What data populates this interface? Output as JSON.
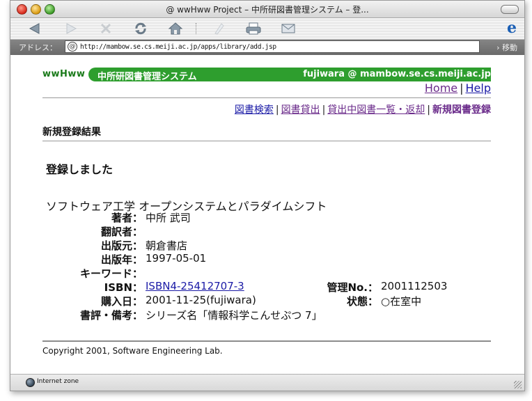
{
  "window": {
    "title": "@ wwHww Project – 中所研図書管理システム – 登..."
  },
  "toolbar": {
    "buttons": [
      "back-icon",
      "forward-icon",
      "stop-icon",
      "refresh-icon",
      "home-icon",
      "favorites-icon",
      "print-icon",
      "mail-icon"
    ]
  },
  "address": {
    "label": "アドレス：",
    "url": "http://mambow.se.cs.meiji.ac.jp/apps/library/add.jsp",
    "go_label": "› 移動"
  },
  "header": {
    "logo": "wwHww",
    "system_name": "中所研図書管理システム",
    "user": "fujiwara @ mambow.se.cs.meiji.ac.jp",
    "home_link": "Home",
    "help_link": "Help"
  },
  "nav": {
    "search": "図書検索",
    "lend": "図書貸出",
    "return": "貸出中図書一覧・返却",
    "register": "新規図書登録"
  },
  "section_title": "新規登録結果",
  "message": "登録しました",
  "book": {
    "title": "ソフトウェア工学 オープンシステムとパラダイムシフト",
    "author_label": "著者：",
    "author": "中所 武司",
    "translator_label": "翻訳者：",
    "translator": "",
    "publisher_label": "出版元：",
    "publisher": "朝倉書店",
    "year_label": "出版年：",
    "year": "1997-05-01",
    "keyword_label": "キーワード：",
    "keyword": "",
    "isbn_label": "ISBN：",
    "isbn": "ISBN4-25412707-3",
    "management_label": "管理No.：",
    "management_no": "2001112503",
    "purchase_label": "購入日：",
    "purchase": "2001-11-25(fujiwara)",
    "status_label": "状態：",
    "status": "○在室中",
    "notes_label": "書評・備考：",
    "notes": "シリーズ名「情報科学こんせぷつ 7」"
  },
  "footer": {
    "copyright": "Copyright 2001, Software Engineering Lab."
  },
  "status_bar": {
    "zone": "Internet zone"
  }
}
